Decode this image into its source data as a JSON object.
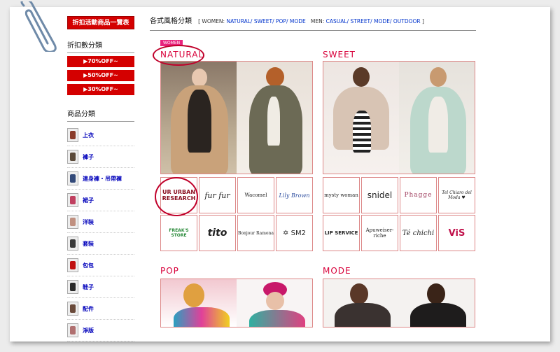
{
  "sidebar": {
    "sale_button": "折扣活動商品一覽表",
    "discount_heading": "折扣數分類",
    "discounts": [
      "▶70%OFF~",
      "▶50%OFF~",
      "▶30%OFF~"
    ],
    "category_heading": "商品分類",
    "categories": [
      {
        "label": "上衣",
        "color": "#8a3b2a"
      },
      {
        "label": "褲子",
        "color": "#5b4a3a"
      },
      {
        "label": "連身褲・吊帶褲",
        "color": "#334a7a"
      },
      {
        "label": "裙子",
        "color": "#c04060"
      },
      {
        "label": "洋裝",
        "color": "#c09080"
      },
      {
        "label": "套裝",
        "color": "#3a3a3a"
      },
      {
        "label": "包包",
        "color": "#c01010"
      },
      {
        "label": "鞋子",
        "color": "#2a2a2a"
      },
      {
        "label": "配件",
        "color": "#6a4a3a"
      },
      {
        "label": "淨版",
        "color": "#b07070"
      }
    ]
  },
  "header": {
    "title": "各式風格分類",
    "bracket_open": "[ WOMEN:",
    "women_links": [
      "NATURAL/",
      "SWEET/",
      "POP/",
      "MODE"
    ],
    "men_prefix": "MEN:",
    "men_links": [
      "CASUAL/",
      "STREET/",
      "MODE/",
      "OUTDOOR"
    ],
    "bracket_close": "]"
  },
  "sections": {
    "natural": {
      "title": "NATURAL",
      "tag": "WOMEN",
      "brands": [
        "UR URBAN RESEARCH",
        "fur fur",
        "Wacomel",
        "Lily Brown",
        "FREAK'S STORE",
        "tito",
        "Bonjour Ramona",
        "✡ SM2"
      ]
    },
    "sweet": {
      "title": "SWEET",
      "brands": [
        "mysty woman",
        "snidel",
        "Phagge",
        "Tel Chiaro del Moda ♥",
        "LIP SERVICE",
        "Apuweiser-riche",
        "Té chichi",
        "ViS"
      ]
    },
    "pop": {
      "title": "POP"
    },
    "mode": {
      "title": "MODE"
    }
  },
  "accent_color": "#d40000"
}
